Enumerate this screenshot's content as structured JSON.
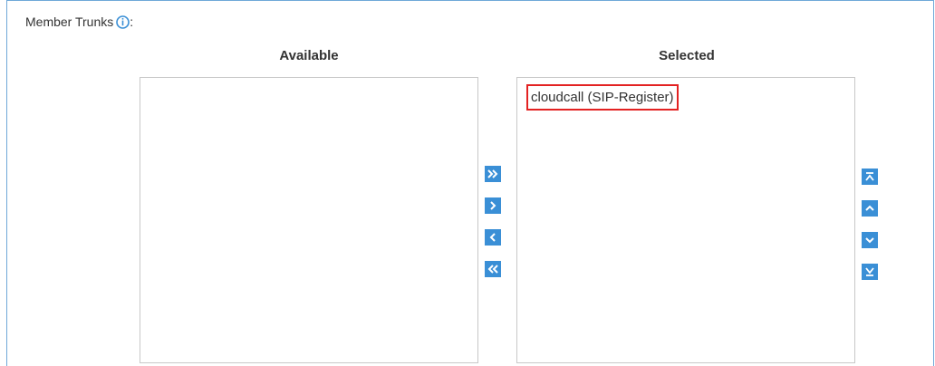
{
  "section": {
    "label": "Member Trunks",
    "suffix": ":",
    "info_icon": "info-circle-icon"
  },
  "available": {
    "header": "Available",
    "items": []
  },
  "selected": {
    "header": "Selected",
    "items": [
      "cloudcall (SIP-Register)"
    ]
  },
  "transfer_buttons": [
    {
      "name": "move-all-right-button",
      "icon": "double-chevron-right-icon"
    },
    {
      "name": "move-right-button",
      "icon": "chevron-right-icon"
    },
    {
      "name": "move-left-button",
      "icon": "chevron-left-icon"
    },
    {
      "name": "move-all-left-button",
      "icon": "double-chevron-left-icon"
    }
  ],
  "order_buttons": [
    {
      "name": "move-to-top-button",
      "icon": "move-top-icon"
    },
    {
      "name": "move-up-button",
      "icon": "chevron-up-icon"
    },
    {
      "name": "move-down-button",
      "icon": "chevron-down-icon"
    },
    {
      "name": "move-to-bottom-button",
      "icon": "move-bottom-icon"
    }
  ],
  "colors": {
    "accent": "#3a8fd6",
    "highlight_border": "#e32222",
    "frame_border": "#6fa8d8"
  }
}
